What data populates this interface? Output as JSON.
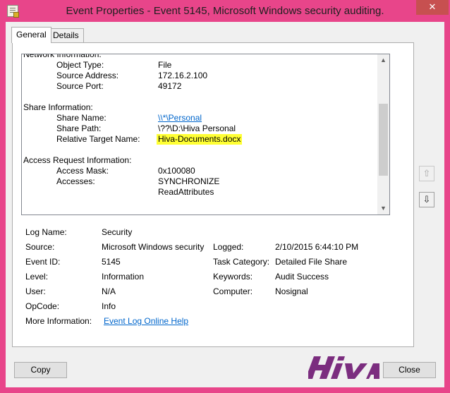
{
  "window": {
    "title": "Event Properties - Event 5145, Microsoft Windows security auditing.",
    "close_glyph": "✕"
  },
  "tabs": [
    {
      "label": "General"
    },
    {
      "label": "Details"
    }
  ],
  "description": {
    "network_heading": "Network Information:",
    "object_type_label": "Object Type:",
    "object_type_value": "File",
    "source_address_label": "Source Address:",
    "source_address_value": "172.16.2.100",
    "source_port_label": "Source Port:",
    "source_port_value": "49172",
    "share_heading": "Share Information:",
    "share_name_label": "Share Name:",
    "share_name_value": "\\\\*\\Personal",
    "share_path_label": "Share Path:",
    "share_path_value": "\\??\\D:\\Hiva Personal",
    "relative_target_label": "Relative Target Name:",
    "relative_target_value": "Hiva-Documents.docx",
    "access_heading": "Access Request Information:",
    "access_mask_label": "Access Mask:",
    "access_mask_value": "0x100080",
    "accesses_label": "Accesses:",
    "accesses_value_1": "SYNCHRONIZE",
    "accesses_value_2": "ReadAttributes",
    "highlight_color": "#ffff33"
  },
  "details": {
    "log_name_label": "Log Name:",
    "log_name": "Security",
    "source_label": "Source:",
    "source": "Microsoft Windows security",
    "logged_label": "Logged:",
    "logged": "2/10/2015 6:44:10 PM",
    "event_id_label": "Event ID:",
    "event_id": "5145",
    "task_category_label": "Task Category:",
    "task_category": "Detailed File Share",
    "level_label": "Level:",
    "level": "Information",
    "keywords_label": "Keywords:",
    "keywords": "Audit Success",
    "user_label": "User:",
    "user": "N/A",
    "computer_label": "Computer:",
    "computer": "Nosignal",
    "opcode_label": "OpCode:",
    "opcode": "Info",
    "more_info_label": "More Information:",
    "more_info_link": "Event Log Online Help"
  },
  "nav": {
    "up_glyph": "⇧",
    "down_glyph": "⇩"
  },
  "buttons": {
    "copy": "Copy",
    "close": "Close"
  },
  "logo": {
    "text": "HIVA",
    "color": "#7b2d7f"
  },
  "colors": {
    "window_frame": "#e8458a",
    "dialog_bg": "#f0f0f0",
    "link": "#0066cc"
  }
}
